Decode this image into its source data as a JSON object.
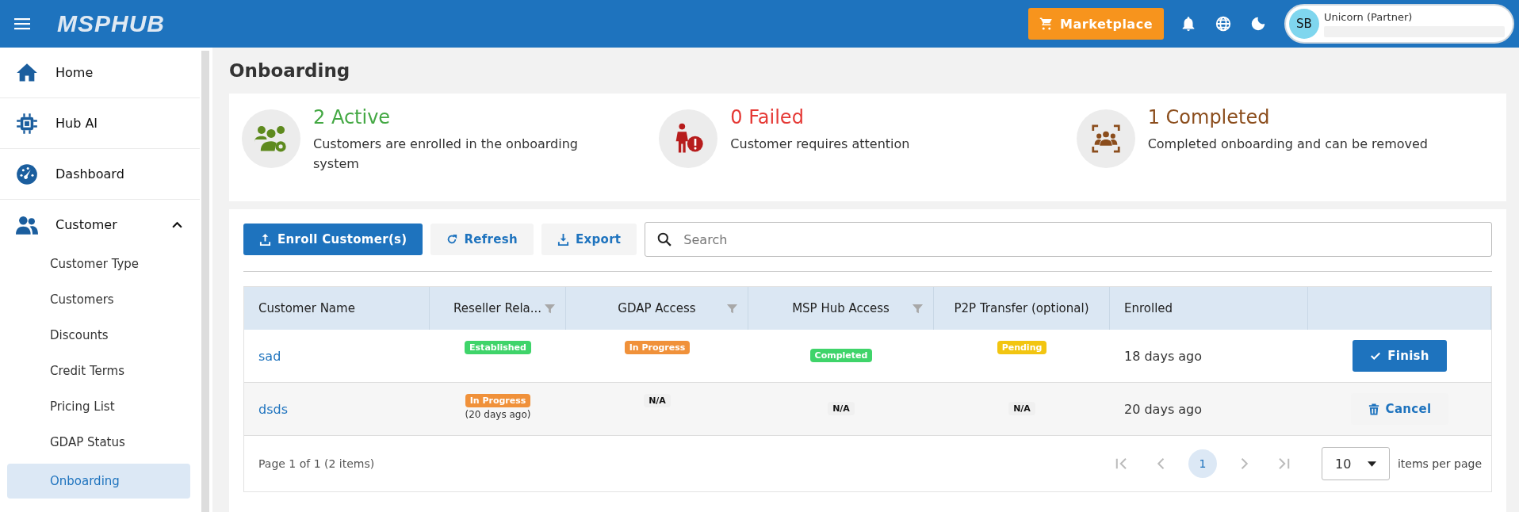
{
  "header": {
    "logo": "MSPHUB",
    "marketplace": "Marketplace",
    "user": {
      "initials": "SB",
      "name": "Unicorn (Partner)"
    }
  },
  "sidebar": {
    "items": [
      {
        "kind": "home",
        "label": "Home"
      },
      {
        "kind": "chip",
        "label": "Hub AI"
      },
      {
        "kind": "gauge",
        "label": "Dashboard"
      },
      {
        "kind": "people",
        "label": "Customer",
        "expanded": true,
        "children": [
          {
            "label": "Customer Type",
            "selected": false
          },
          {
            "label": "Customers",
            "selected": false
          },
          {
            "label": "Discounts",
            "selected": false
          },
          {
            "label": "Credit Terms",
            "selected": false
          },
          {
            "label": "Pricing List",
            "selected": false
          },
          {
            "label": "GDAP Status",
            "selected": false
          },
          {
            "label": "Onboarding",
            "selected": true
          }
        ]
      }
    ]
  },
  "page_title": "Onboarding",
  "stats": [
    {
      "kind": "active",
      "value": "2 Active",
      "color": "#43a843",
      "description": "Customers are enrolled in the onboarding system"
    },
    {
      "kind": "failed",
      "value": "0 Failed",
      "color": "#e53935",
      "description": "Customer requires attention"
    },
    {
      "kind": "completed",
      "value": "1 Completed",
      "color": "#8b4d1c",
      "description": "Completed onboarding and can be removed"
    }
  ],
  "toolbar": {
    "enroll": "Enroll Customer(s)",
    "refresh": "Refresh",
    "export": "Export",
    "search": {
      "placeholder": "Search"
    }
  },
  "table": {
    "columns": [
      {
        "label": "Customer Name",
        "filter": false
      },
      {
        "label": "Reseller Rela...",
        "filter": true
      },
      {
        "label": "GDAP Access",
        "filter": true
      },
      {
        "label": "MSP Hub Access",
        "filter": true
      },
      {
        "label": "P2P Transfer (optional)",
        "filter": false
      },
      {
        "label": "Enrolled",
        "filter": false
      }
    ],
    "rows": [
      {
        "name": "sad",
        "reseller": {
          "kind": "established",
          "label": "Established"
        },
        "gdap": {
          "kind": "in_progress",
          "label": "In Progress"
        },
        "msp": {
          "kind": "completed",
          "label": "Completed"
        },
        "p2p": {
          "kind": "pending",
          "label": "Pending"
        },
        "enrolled": "18 days ago",
        "action": {
          "kind": "finish",
          "label": "Finish"
        }
      },
      {
        "name": "dsds",
        "reseller": {
          "kind": "in_progress",
          "label": "In Progress",
          "note": "(20 days ago)"
        },
        "gdap": {
          "kind": "na",
          "label": "N/A"
        },
        "msp": {
          "kind": "na",
          "label": "N/A"
        },
        "p2p": {
          "kind": "na",
          "label": "N/A"
        },
        "enrolled": "20 days ago",
        "action": {
          "kind": "cancel",
          "label": "Cancel"
        }
      }
    ]
  },
  "pager": {
    "summary": "Page 1 of 1 (2 items)",
    "pages": [
      {
        "label": "1",
        "selected": true
      }
    ],
    "page_size": "10",
    "page_size_label": "items per page"
  }
}
